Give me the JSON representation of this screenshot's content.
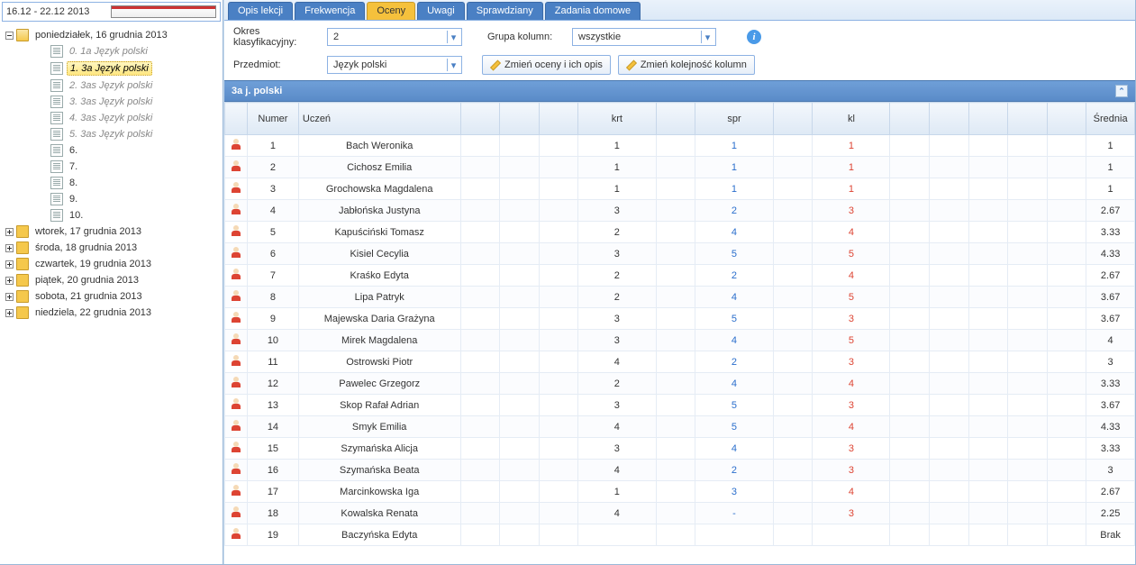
{
  "dateRange": "16.12 - 22.12 2013",
  "tree": {
    "root": {
      "label": "poniedziałek, 16 grudnia 2013"
    },
    "lessons": [
      {
        "label": "0. 1a Język polski",
        "gray": true
      },
      {
        "label": "1. 3a Język polski",
        "selected": true
      },
      {
        "label": "2. 3as Język polski",
        "gray": true
      },
      {
        "label": "3. 3as Język polski",
        "gray": true
      },
      {
        "label": "4. 3as Język polski",
        "gray": true
      },
      {
        "label": "5. 3as Język polski",
        "gray": true
      },
      {
        "label": "6."
      },
      {
        "label": "7."
      },
      {
        "label": "8."
      },
      {
        "label": "9."
      },
      {
        "label": "10."
      }
    ],
    "days": [
      {
        "label": "wtorek, 17 grudnia 2013"
      },
      {
        "label": "środa, 18 grudnia 2013"
      },
      {
        "label": "czwartek, 19 grudnia 2013"
      },
      {
        "label": "piątek, 20 grudnia 2013"
      },
      {
        "label": "sobota, 21 grudnia 2013"
      },
      {
        "label": "niedziela, 22 grudnia 2013"
      }
    ]
  },
  "tabs": [
    {
      "label": "Opis lekcji"
    },
    {
      "label": "Frekwencja"
    },
    {
      "label": "Oceny",
      "active": true
    },
    {
      "label": "Uwagi"
    },
    {
      "label": "Sprawdziany"
    },
    {
      "label": "Zadania domowe"
    }
  ],
  "toolbar": {
    "periodLabel": "Okres klasyfikacyjny:",
    "periodValue": "2",
    "groupLabel": "Grupa kolumn:",
    "groupValue": "wszystkie",
    "subjectLabel": "Przedmiot:",
    "subjectValue": "Język polski",
    "btnEditGrades": "Zmień oceny i ich opis",
    "btnReorder": "Zmień kolejność kolumn"
  },
  "section": {
    "title": "3a j. polski"
  },
  "columns": {
    "numer": "Numer",
    "uczen": "Uczeń",
    "krt": "krt",
    "spr": "spr",
    "kl": "kl",
    "avg": "Średnia"
  },
  "rows": [
    {
      "num": "1",
      "name": "Bach Weronika",
      "krt": "1",
      "spr": "1",
      "kl": "1",
      "avg": "1"
    },
    {
      "num": "2",
      "name": "Cichosz Emilia",
      "krt": "1",
      "spr": "1",
      "kl": "1",
      "avg": "1"
    },
    {
      "num": "3",
      "name": "Grochowska Magdalena",
      "krt": "1",
      "spr": "1",
      "kl": "1",
      "avg": "1"
    },
    {
      "num": "4",
      "name": "Jabłońska Justyna",
      "krt": "3",
      "spr": "2",
      "kl": "3",
      "avg": "2.67"
    },
    {
      "num": "5",
      "name": "Kapuściński Tomasz",
      "krt": "2",
      "spr": "4",
      "kl": "4",
      "avg": "3.33"
    },
    {
      "num": "6",
      "name": "Kisiel Cecylia",
      "krt": "3",
      "spr": "5",
      "kl": "5",
      "avg": "4.33"
    },
    {
      "num": "7",
      "name": "Kraśko Edyta",
      "krt": "2",
      "spr": "2",
      "kl": "4",
      "avg": "2.67"
    },
    {
      "num": "8",
      "name": "Lipa Patryk",
      "krt": "2",
      "spr": "4",
      "kl": "5",
      "avg": "3.67"
    },
    {
      "num": "9",
      "name": "Majewska Daria Grażyna",
      "krt": "3",
      "spr": "5",
      "kl": "3",
      "avg": "3.67"
    },
    {
      "num": "10",
      "name": "Mirek Magdalena",
      "krt": "3",
      "spr": "4",
      "kl": "5",
      "avg": "4"
    },
    {
      "num": "11",
      "name": "Ostrowski Piotr",
      "krt": "4",
      "spr": "2",
      "kl": "3",
      "avg": "3"
    },
    {
      "num": "12",
      "name": "Pawelec Grzegorz",
      "krt": "2",
      "spr": "4",
      "kl": "4",
      "avg": "3.33"
    },
    {
      "num": "13",
      "name": "Skop Rafał Adrian",
      "krt": "3",
      "spr": "5",
      "kl": "3",
      "avg": "3.67"
    },
    {
      "num": "14",
      "name": "Smyk Emilia",
      "krt": "4",
      "spr": "5",
      "kl": "4",
      "avg": "4.33"
    },
    {
      "num": "15",
      "name": "Szymańska Alicja",
      "krt": "3",
      "spr": "4",
      "kl": "3",
      "avg": "3.33"
    },
    {
      "num": "16",
      "name": "Szymańska Beata",
      "krt": "4",
      "spr": "2",
      "kl": "3",
      "avg": "3"
    },
    {
      "num": "17",
      "name": "Marcinkowska Iga",
      "krt": "1",
      "spr": "3",
      "kl": "4",
      "avg": "2.67"
    },
    {
      "num": "18",
      "name": "Kowalska Renata",
      "krt": "4",
      "spr": "-",
      "kl": "3",
      "avg": "2.25"
    },
    {
      "num": "19",
      "name": "Baczyńska Edyta",
      "krt": "",
      "spr": "",
      "kl": "",
      "avg": "Brak"
    }
  ]
}
